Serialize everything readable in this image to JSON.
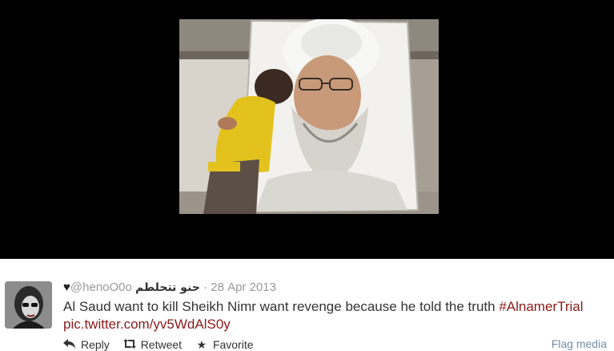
{
  "media": {
    "image_description_icon": "photo-icon"
  },
  "tweet": {
    "heart": "♥",
    "handle": "@henoO0o",
    "display_name": "حنو تتحلطم",
    "separator": "·",
    "date": "28 Apr 2013",
    "text_prefix": "Al Saud want to kill Sheikh Nimr want revenge because he told the truth ",
    "hashtag": "#AlnamerTrial",
    "pic_link": "pic.twitter.com/yv5WdAlS0y"
  },
  "actions": {
    "reply": "Reply",
    "retweet": "Retweet",
    "favorite": "Favorite",
    "flag_media": "Flag media"
  },
  "colors": {
    "link": "#8b1a1a",
    "flag": "#6f8fa8",
    "text": "#333333",
    "muted": "#999999",
    "media_bg": "#000000"
  }
}
